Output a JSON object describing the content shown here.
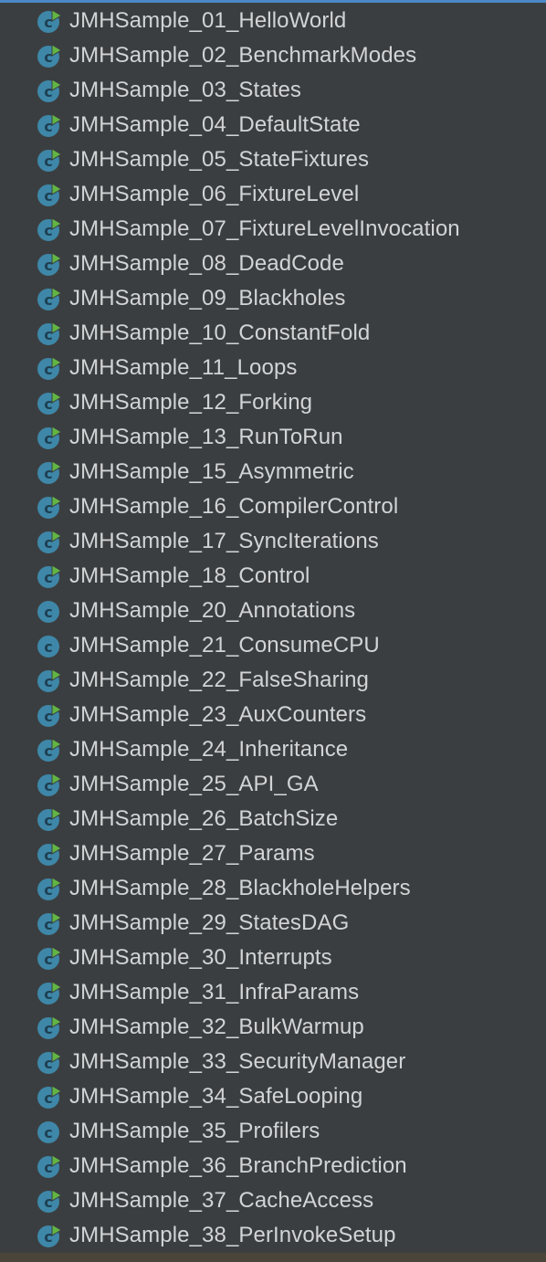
{
  "colors": {
    "background": "#3b3e40",
    "text": "#d2d4d6",
    "class_icon": "#3e87a8",
    "runnable_marker": "#62b543",
    "top_accent": "#4a88c7"
  },
  "tree": {
    "items": [
      {
        "label": "JMHSample_01_HelloWorld",
        "icon": "class-runnable-icon",
        "runnable": true
      },
      {
        "label": "JMHSample_02_BenchmarkModes",
        "icon": "class-runnable-icon",
        "runnable": true
      },
      {
        "label": "JMHSample_03_States",
        "icon": "class-runnable-icon",
        "runnable": true
      },
      {
        "label": "JMHSample_04_DefaultState",
        "icon": "class-runnable-icon",
        "runnable": true
      },
      {
        "label": "JMHSample_05_StateFixtures",
        "icon": "class-runnable-icon",
        "runnable": true
      },
      {
        "label": "JMHSample_06_FixtureLevel",
        "icon": "class-runnable-icon",
        "runnable": true
      },
      {
        "label": "JMHSample_07_FixtureLevelInvocation",
        "icon": "class-runnable-icon",
        "runnable": true
      },
      {
        "label": "JMHSample_08_DeadCode",
        "icon": "class-runnable-icon",
        "runnable": true
      },
      {
        "label": "JMHSample_09_Blackholes",
        "icon": "class-runnable-icon",
        "runnable": true
      },
      {
        "label": "JMHSample_10_ConstantFold",
        "icon": "class-runnable-icon",
        "runnable": true
      },
      {
        "label": "JMHSample_11_Loops",
        "icon": "class-runnable-icon",
        "runnable": true
      },
      {
        "label": "JMHSample_12_Forking",
        "icon": "class-runnable-icon",
        "runnable": true
      },
      {
        "label": "JMHSample_13_RunToRun",
        "icon": "class-runnable-icon",
        "runnable": true
      },
      {
        "label": "JMHSample_15_Asymmetric",
        "icon": "class-runnable-icon",
        "runnable": true
      },
      {
        "label": "JMHSample_16_CompilerControl",
        "icon": "class-runnable-icon",
        "runnable": true
      },
      {
        "label": "JMHSample_17_SyncIterations",
        "icon": "class-runnable-icon",
        "runnable": true
      },
      {
        "label": "JMHSample_18_Control",
        "icon": "class-runnable-icon",
        "runnable": true
      },
      {
        "label": "JMHSample_20_Annotations",
        "icon": "class-icon",
        "runnable": false
      },
      {
        "label": "JMHSample_21_ConsumeCPU",
        "icon": "class-icon",
        "runnable": false
      },
      {
        "label": "JMHSample_22_FalseSharing",
        "icon": "class-runnable-icon",
        "runnable": true
      },
      {
        "label": "JMHSample_23_AuxCounters",
        "icon": "class-runnable-icon",
        "runnable": true
      },
      {
        "label": "JMHSample_24_Inheritance",
        "icon": "class-runnable-icon",
        "runnable": true
      },
      {
        "label": "JMHSample_25_API_GA",
        "icon": "class-runnable-icon",
        "runnable": true
      },
      {
        "label": "JMHSample_26_BatchSize",
        "icon": "class-runnable-icon",
        "runnable": true
      },
      {
        "label": "JMHSample_27_Params",
        "icon": "class-runnable-icon",
        "runnable": true
      },
      {
        "label": "JMHSample_28_BlackholeHelpers",
        "icon": "class-runnable-icon",
        "runnable": true
      },
      {
        "label": "JMHSample_29_StatesDAG",
        "icon": "class-runnable-icon",
        "runnable": true
      },
      {
        "label": "JMHSample_30_Interrupts",
        "icon": "class-runnable-icon",
        "runnable": true
      },
      {
        "label": "JMHSample_31_InfraParams",
        "icon": "class-runnable-icon",
        "runnable": true
      },
      {
        "label": "JMHSample_32_BulkWarmup",
        "icon": "class-runnable-icon",
        "runnable": true
      },
      {
        "label": "JMHSample_33_SecurityManager",
        "icon": "class-runnable-icon",
        "runnable": true
      },
      {
        "label": "JMHSample_34_SafeLooping",
        "icon": "class-runnable-icon",
        "runnable": true
      },
      {
        "label": "JMHSample_35_Profilers",
        "icon": "class-icon",
        "runnable": false
      },
      {
        "label": "JMHSample_36_BranchPrediction",
        "icon": "class-runnable-icon",
        "runnable": true
      },
      {
        "label": "JMHSample_37_CacheAccess",
        "icon": "class-runnable-icon",
        "runnable": true
      },
      {
        "label": "JMHSample_38_PerInvokeSetup",
        "icon": "class-runnable-icon",
        "runnable": true
      }
    ]
  }
}
